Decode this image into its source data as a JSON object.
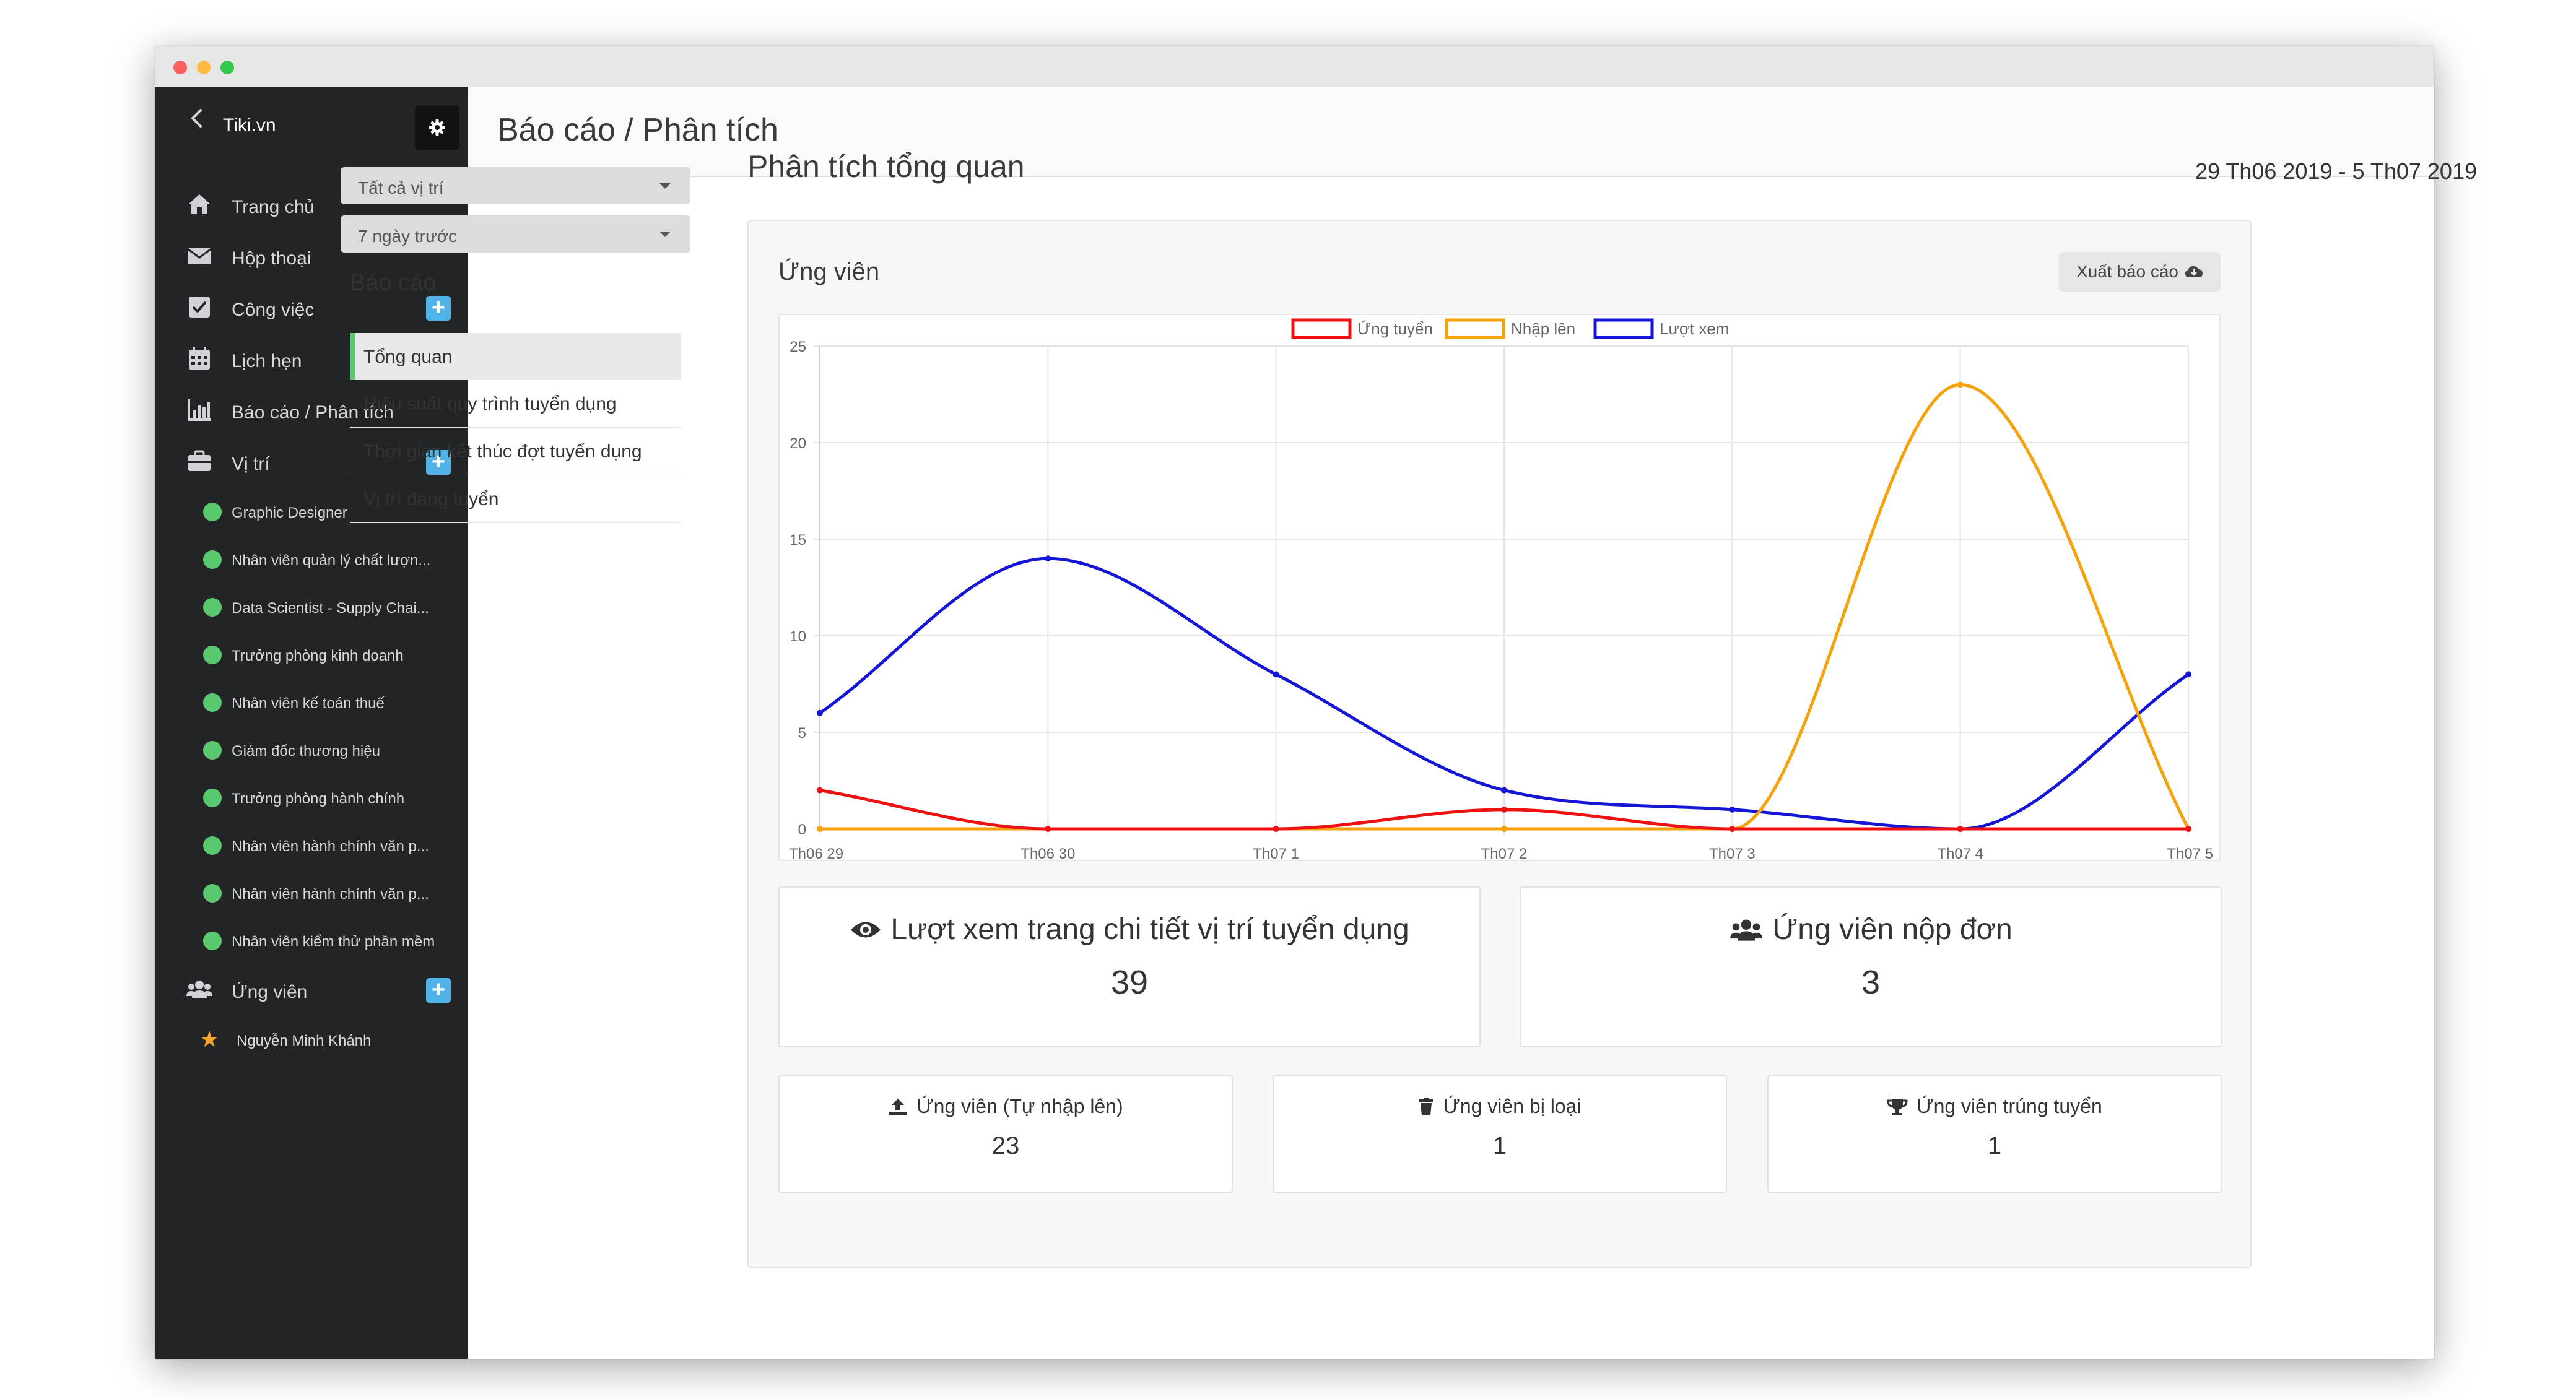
{
  "sidebar": {
    "brand": "Tiki.vn",
    "nav": [
      {
        "label": "Trang chủ",
        "icon": "home-icon"
      },
      {
        "label": "Hộp thoại",
        "icon": "envelope-icon"
      },
      {
        "label": "Công việc",
        "icon": "checkbox-icon",
        "has_add": true
      },
      {
        "label": "Lịch hẹn",
        "icon": "calendar-icon"
      },
      {
        "label": "Báo cáo / Phân tích",
        "icon": "bar-chart-icon"
      },
      {
        "label": "Vị trí",
        "icon": "briefcase-icon",
        "has_add": true
      }
    ],
    "positions": [
      "Graphic Designer",
      "Nhân viên quản lý chất lượn...",
      "Data Scientist - Supply Chai...",
      "Trưởng phòng kinh doanh",
      "Nhân viên kế toán thuế",
      "Giám đốc thương hiệu",
      "Trưởng phòng hành chính",
      "Nhân viên hành chính văn p...",
      "Nhân viên hành chính văn p...",
      "Nhân viên kiểm thử phần mềm"
    ],
    "candidates_label": "Ứng viên",
    "candidates": [
      "Nguyễn Minh Khánh"
    ]
  },
  "header": {
    "title": "Báo cáo / Phân tích"
  },
  "filters": {
    "position_select": "Tất cả vị trí",
    "period_select": "7 ngày trước",
    "report_heading": "Báo cáo",
    "reports": [
      "Tổng quan",
      "Hiệu suất quy trình tuyển dụng",
      "Thời gian kết thúc đợt tuyển dụng",
      "Vị trí đang tuyển"
    ],
    "active_report": 0
  },
  "main": {
    "title": "Phân tích tổng quan",
    "date_range": "29 Th06 2019 - 5 Th07 2019",
    "card_title": "Ứng viên",
    "export_label": "Xuất báo cáo"
  },
  "chart_data": {
    "type": "line",
    "categories": [
      "Th06 29",
      "Th06 30",
      "Th07 1",
      "Th07 2",
      "Th07 3",
      "Th07 4",
      "Th07 5"
    ],
    "series": [
      {
        "name": "Ứng tuyển",
        "color": "#ee1111",
        "values": [
          2,
          0,
          0,
          1,
          0,
          0,
          0
        ]
      },
      {
        "name": "Nhập lên",
        "color": "#f5a20c",
        "values": [
          0,
          0,
          0,
          0,
          0,
          23,
          0
        ]
      },
      {
        "name": "Lượt xem",
        "color": "#1515d6",
        "values": [
          6,
          14,
          8,
          2,
          1,
          0,
          8
        ]
      }
    ],
    "ylim": [
      0,
      25
    ],
    "yticks": [
      0,
      5,
      10,
      15,
      20,
      25
    ],
    "legend": "top-center",
    "grid": true
  },
  "stats": {
    "views": {
      "label": "Lượt xem trang chi tiết vị trí tuyển dụng",
      "value": "39"
    },
    "applicants": {
      "label": "Ứng viên nộp đơn",
      "value": "3"
    },
    "uploaded": {
      "label": "Ứng viên (Tự nhập lên)",
      "value": "23"
    },
    "rejected": {
      "label": "Ứng viên bị loại",
      "value": "1"
    },
    "hired": {
      "label": "Ứng viên trúng tuyển",
      "value": "1"
    }
  }
}
